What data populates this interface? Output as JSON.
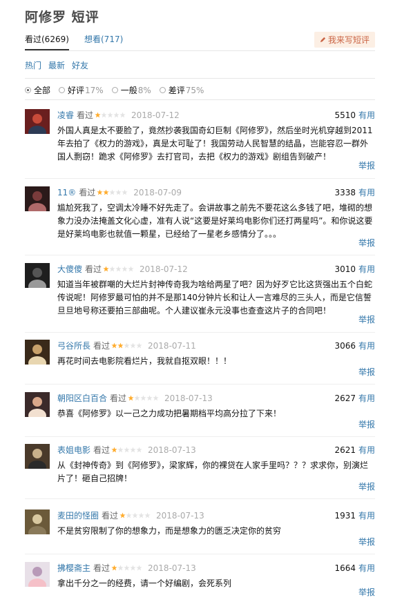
{
  "page": {
    "title": "阿修罗 短评"
  },
  "tabs": [
    {
      "label": "看过(6269)"
    },
    {
      "label": "想看(717)"
    }
  ],
  "write_button": {
    "label": "我来写短评"
  },
  "sorts": [
    "热门",
    "最新",
    "好友"
  ],
  "filters": [
    {
      "label": "全部",
      "pct": ""
    },
    {
      "label": "好评",
      "pct": "17%"
    },
    {
      "label": "一般",
      "pct": "8%"
    },
    {
      "label": "差评",
      "pct": "75%"
    }
  ],
  "useful_label": "有用",
  "report_label": "举报",
  "comments": [
    {
      "user": "凌睿",
      "status": "看过",
      "rating": 1,
      "date": "2018-07-12",
      "votes": "5510",
      "text": "外国人真是太不要脸了，竟然抄袭我国奇幻巨制《阿修罗》，然后坐时光机穿越到2011年去拍了《权力的游戏》，真是太可耻了！我国劳动人民智慧的结晶，岂能容忍一群外国人剽窃！跪求《阿修罗》去打官司，去把《权力的游戏》剧组告到破产！",
      "avatar_colors": [
        "#6a1f1f",
        "#c84b3a",
        "#2d3b55"
      ]
    },
    {
      "user": "11®",
      "status": "看过",
      "rating": 2,
      "date": "2018-07-09",
      "votes": "3338",
      "text": "尴尬死我了，空调太冷睡不好先走了。会讲故事之前先不要花这么多钱了吧，堆砌的想象力没办法掩盖文化心虚，准有人说“这要是好莱坞电影你们还打两星吗”。和你说这要是好莱坞电影也就值一颗星，已经给了一星老乡感情分了。。。",
      "avatar_colors": [
        "#2b1a1a",
        "#7a3b3b",
        "#b06a6a"
      ]
    },
    {
      "user": "大傻傻",
      "status": "看过",
      "rating": 1,
      "date": "2018-07-12",
      "votes": "3010",
      "text": "知道当年被群嘲的大烂片封神传奇我为啥给两星了吧？因为好歹它比这货强出五个白蛇传说呢！阿修罗最可怕的并不是那140分钟片长和让人一言难尽的三头人，而是它信誓旦旦地号称还要拍三部曲呢。个人建议崔永元没事也查查这片子的合同吧！",
      "avatar_colors": [
        "#1e1e1e",
        "#555555",
        "#999999"
      ]
    },
    {
      "user": "弓谷所長",
      "status": "看过",
      "rating": 2,
      "date": "2018-07-11",
      "votes": "3066",
      "text": "再花时间去电影院看烂片，我就自抠双眼！！！",
      "avatar_colors": [
        "#3a2a1a",
        "#c9a26b",
        "#e8d6b0"
      ]
    },
    {
      "user": "朝阳区白百合",
      "status": "看过",
      "rating": 1,
      "date": "2018-07-13",
      "votes": "2627",
      "text": "恭喜《阿修罗》以一己之力成功把暑期档平均高分拉了下来！",
      "avatar_colors": [
        "#3b2a2a",
        "#d9a78a",
        "#f2e0d0"
      ]
    },
    {
      "user": "表姐电影",
      "status": "看过",
      "rating": 1,
      "date": "2018-07-13",
      "votes": "2621",
      "text": "从《封神传奇》到《阿修罗》，梁家辉，你的裸贷在人家手里吗？？？求求你，别演烂片了！砸自己招牌！",
      "avatar_colors": [
        "#4a3a2a",
        "#c8b08a",
        "#2a2a2a"
      ]
    },
    {
      "user": "麦田的怪圈",
      "status": "看过",
      "rating": 1,
      "date": "2018-07-13",
      "votes": "1931",
      "text": "不是贫穷限制了你的想象力，而是想象力的匮乏决定你的贫穷",
      "avatar_colors": [
        "#6b5a3a",
        "#d8c8a0",
        "#8a7a5a"
      ]
    },
    {
      "user": "拂樱斋主",
      "status": "看过",
      "rating": 1,
      "date": "2018-07-13",
      "votes": "1664",
      "text": "拿出千分之一的经费，请一个好编剧，会死系列",
      "avatar_colors": [
        "#e8e0e8",
        "#b89ab8",
        "#f5c0c8"
      ]
    }
  ]
}
